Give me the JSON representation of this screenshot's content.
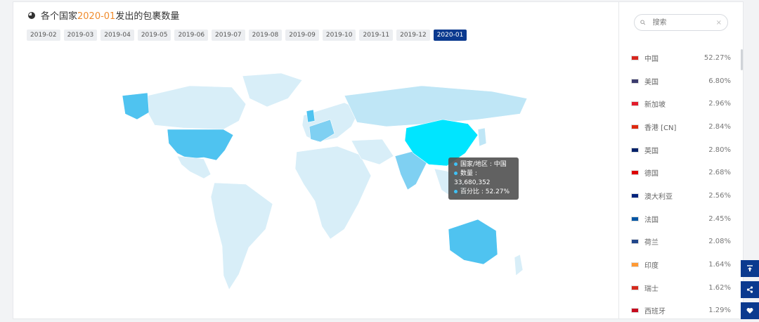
{
  "title": {
    "prefix": "各个国家",
    "highlight": "2020-01",
    "suffix": "发出的包裹数量"
  },
  "months": [
    "2019-02",
    "2019-03",
    "2019-04",
    "2019-05",
    "2019-06",
    "2019-07",
    "2019-08",
    "2019-09",
    "2019-10",
    "2019-11",
    "2019-12",
    "2020-01"
  ],
  "active_month": "2020-01",
  "search": {
    "placeholder": "搜索"
  },
  "countries": [
    {
      "name": "中国",
      "pct": "52.27%",
      "flag": "#d7261e"
    },
    {
      "name": "美国",
      "pct": "6.80%",
      "flag": "#3c3b6e"
    },
    {
      "name": "新加坡",
      "pct": "2.96%",
      "flag": "#e21c2b"
    },
    {
      "name": "香港 [CN]",
      "pct": "2.84%",
      "flag": "#de2910"
    },
    {
      "name": "英国",
      "pct": "2.80%",
      "flag": "#012169"
    },
    {
      "name": "德国",
      "pct": "2.68%",
      "flag": "#dd0000"
    },
    {
      "name": "澳大利亚",
      "pct": "2.56%",
      "flag": "#00247d"
    },
    {
      "name": "法国",
      "pct": "2.45%",
      "flag": "#0055a4"
    },
    {
      "name": "荷兰",
      "pct": "2.08%",
      "flag": "#21468b"
    },
    {
      "name": "印度",
      "pct": "1.64%",
      "flag": "#ff9933"
    },
    {
      "name": "瑞士",
      "pct": "1.62%",
      "flag": "#d52b1e"
    },
    {
      "name": "西班牙",
      "pct": "1.29%",
      "flag": "#c60b1e"
    }
  ],
  "tooltip": {
    "region": "国家/地区 : 中国",
    "count": "数量 : 33,680,352",
    "percent": "百分比 : 52.27%"
  },
  "colors": {
    "accent": "#0b3a8f",
    "highlight": "#f08c2e",
    "map_top": "#00e5ff",
    "map_mid": "#4fc3f0",
    "map_low": "#d8eef8"
  }
}
